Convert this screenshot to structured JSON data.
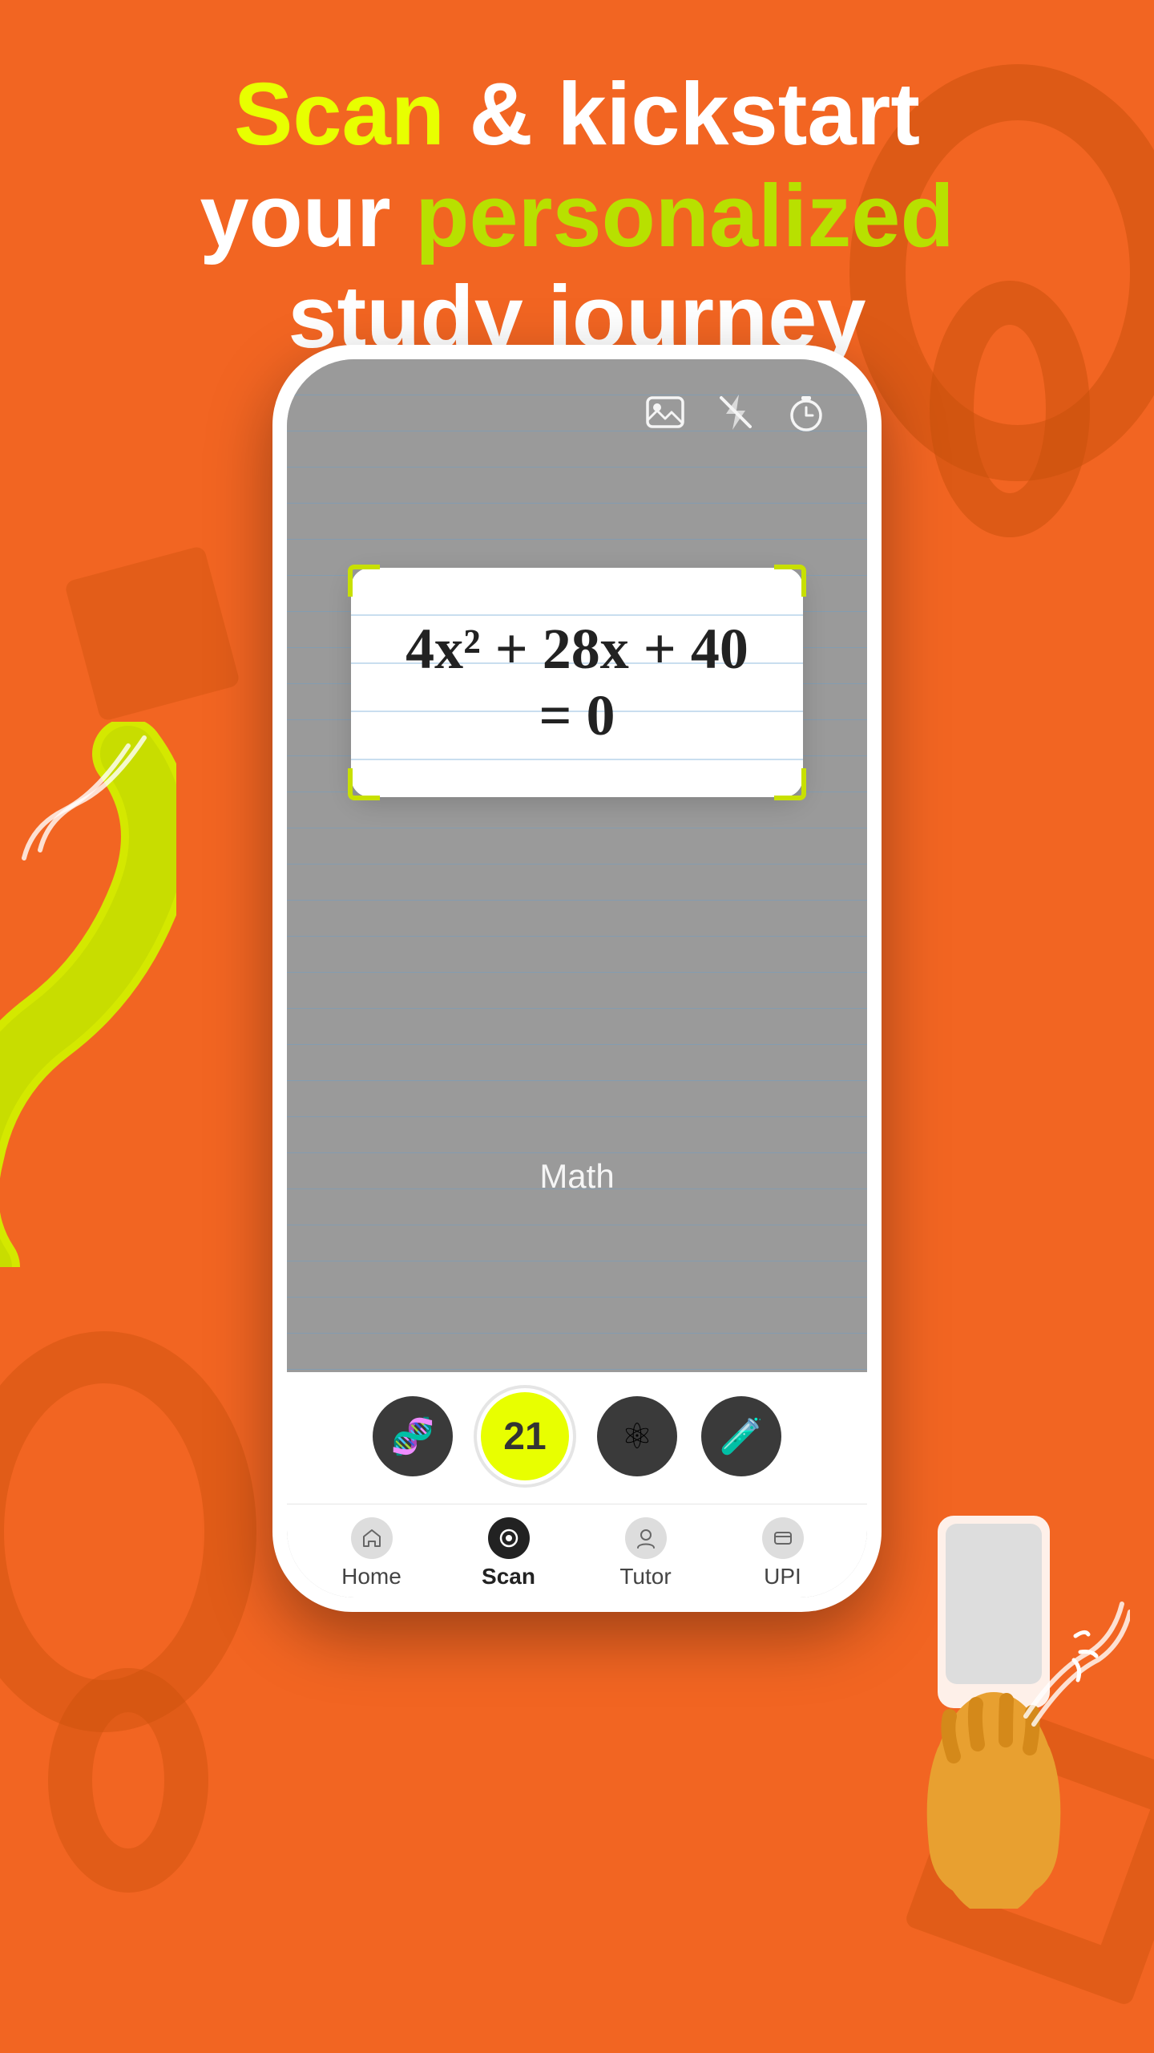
{
  "page": {
    "bg_color": "#F26522"
  },
  "header": {
    "line1_part1": "Scan",
    "line1_part2": " & kickstart",
    "line2_part1": "your ",
    "line2_part2": "personalized",
    "line3": "study journey"
  },
  "camera": {
    "equation": "4x² + 28x + 40 = 0",
    "subject_label": "Math"
  },
  "subject_buttons": [
    {
      "icon": "🧬",
      "label": "biology",
      "active": false
    },
    {
      "icon": "21",
      "label": "math",
      "active": true
    },
    {
      "icon": "⚛",
      "label": "physics",
      "active": false
    },
    {
      "icon": "🧪",
      "label": "chemistry",
      "active": false
    }
  ],
  "nav": {
    "items": [
      {
        "label": "Home",
        "icon": "👤",
        "active": false
      },
      {
        "label": "Scan",
        "icon": "📷",
        "active": true
      },
      {
        "label": "Tutor",
        "icon": "💬",
        "active": false
      },
      {
        "label": "UPI",
        "icon": "💳",
        "active": false
      }
    ]
  },
  "colors": {
    "accent_yellow": "#E8FF00",
    "accent_green": "#B8E000",
    "orange_bg": "#F26522",
    "dark_bg": "#3a3a3a"
  }
}
